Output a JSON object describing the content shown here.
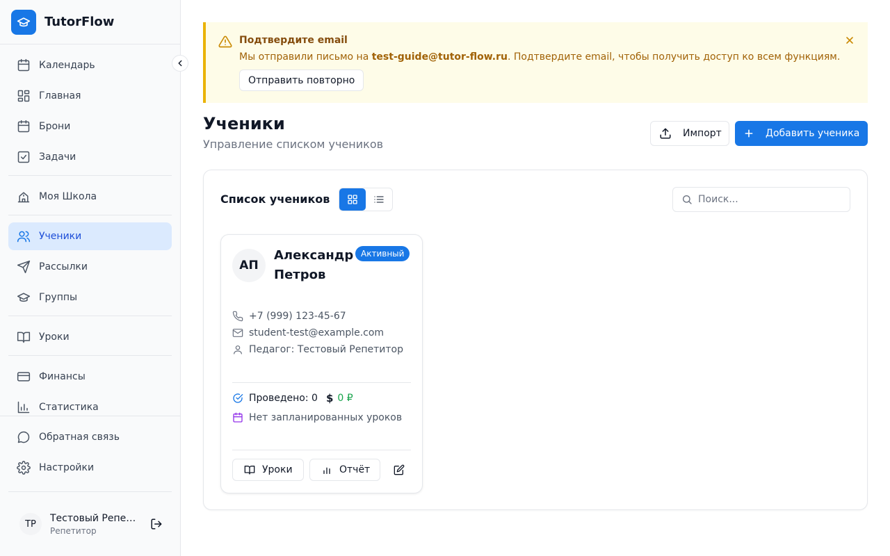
{
  "brand": {
    "name": "TutorFlow",
    "logo_icon": "graduation-cap-icon"
  },
  "sidebar": {
    "items": [
      {
        "label": "Календарь",
        "icon": "calendar-icon"
      },
      {
        "label": "Главная",
        "icon": "dashboard-icon"
      },
      {
        "label": "Брони",
        "icon": "calendar-icon"
      },
      {
        "label": "Задачи",
        "icon": "checkbox-icon"
      },
      {
        "label": "Моя Школа",
        "icon": "school-icon"
      },
      {
        "label": "Ученики",
        "icon": "users-icon",
        "active": true
      },
      {
        "label": "Рассылки",
        "icon": "send-icon"
      },
      {
        "label": "Группы",
        "icon": "graduation-cap-icon"
      },
      {
        "label": "Уроки",
        "icon": "book-icon"
      },
      {
        "label": "Финансы",
        "icon": "credit-card-icon"
      },
      {
        "label": "Статистика",
        "icon": "bar-chart-icon"
      }
    ],
    "bottom_items": [
      {
        "label": "Обратная связь",
        "icon": "message-icon"
      },
      {
        "label": "Настройки",
        "icon": "gear-icon"
      }
    ],
    "user": {
      "initials": "ТР",
      "name": "Тестовый Репетитор",
      "role": "Репетитор"
    }
  },
  "alert": {
    "title": "Подтвердите email",
    "text_before": "Мы отправили письмо на ",
    "email": "test-guide@tutor-flow.ru",
    "text_after": ". Подтвердите email, чтобы получить доступ ко всем функциям.",
    "resend_label": "Отправить повторно"
  },
  "page": {
    "title": "Ученики",
    "subtitle": "Управление списком учеников",
    "import_label": "Импорт",
    "add_label": "Добавить ученика"
  },
  "panel": {
    "title": "Список учеников",
    "search_placeholder": "Поиск...",
    "view_mode": "grid"
  },
  "students": [
    {
      "initials": "АП",
      "name": "Александр Петров",
      "status": "Активный",
      "phone": "+7 (999) 123-45-67",
      "email": "student-test@example.com",
      "teacher": "Педагог: Тестовый Репетитор",
      "conducted": "Проведено: 0",
      "amount": "0 ₽",
      "schedule": "Нет запланированных уроков",
      "lessons_label": "Уроки",
      "report_label": "Отчёт"
    }
  ],
  "colors": {
    "accent": "#1877e6",
    "warning_bg": "#fefce8",
    "warning_border": "#eab308",
    "money": "#16a34a",
    "schedule_icon": "#9333ea"
  }
}
